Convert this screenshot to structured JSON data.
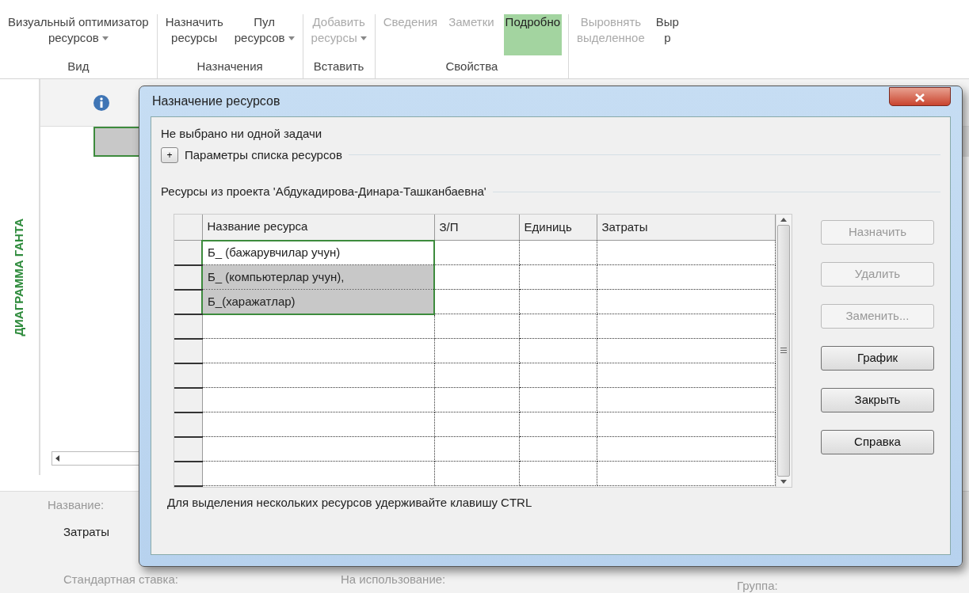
{
  "ribbon": {
    "groups": [
      {
        "label": "Вид",
        "commands": [
          {
            "lines": [
              "Визуальный оптимизатор",
              "ресурсов"
            ],
            "dropdown": true,
            "disabled": false,
            "selected": false
          }
        ]
      },
      {
        "label": "Назначения",
        "commands": [
          {
            "lines": [
              "Назначить",
              "ресурсы"
            ],
            "dropdown": false,
            "disabled": false,
            "selected": false
          },
          {
            "lines": [
              "Пул",
              "ресурсов"
            ],
            "dropdown": true,
            "disabled": false,
            "selected": false
          }
        ]
      },
      {
        "label": "Вставить",
        "commands": [
          {
            "lines": [
              "Добавить",
              "ресурсы"
            ],
            "dropdown": true,
            "disabled": true,
            "selected": false
          }
        ]
      },
      {
        "label": "Свойства",
        "commands": [
          {
            "lines": [
              "Сведения"
            ],
            "dropdown": false,
            "disabled": true,
            "selected": false
          },
          {
            "lines": [
              "Заметки"
            ],
            "dropdown": false,
            "disabled": true,
            "selected": false
          },
          {
            "lines": [
              "Подробно"
            ],
            "dropdown": false,
            "disabled": false,
            "selected": true
          }
        ]
      },
      {
        "commands": [
          {
            "lines": [
              "Выровнять",
              "выделенное"
            ],
            "dropdown": false,
            "disabled": true,
            "selected": false
          },
          {
            "lines": [
              "Выр",
              "р"
            ],
            "dropdown": false,
            "disabled": false,
            "selected": false
          }
        ]
      }
    ]
  },
  "view_bar": {
    "label": "ДИАГРАММА ГАНТА"
  },
  "details_form": {
    "name_label": "Название:",
    "group_title": "Затраты",
    "fields": [
      "Стандартная ставка:",
      "На использование:",
      "Группа:"
    ]
  },
  "dialog": {
    "title": "Назначение ресурсов",
    "task_status": "Не выбрано ни одной задачи",
    "options_toggle": "+",
    "options_label": "Параметры списка ресурсов",
    "resources_label": "Ресурсы из проекта 'Абдукадирова-Динара-Ташканбаевна'",
    "columns": [
      "Название ресурса",
      "З/П",
      "Единиць",
      "Затраты"
    ],
    "rows": [
      {
        "name": "Б_ (бажарувчилар учун)",
        "active": true,
        "selected": false
      },
      {
        "name": "Б_ (компьютерлар учун),",
        "active": false,
        "selected": true
      },
      {
        "name": "Б_(харажатлар)",
        "active": false,
        "selected": true
      },
      {
        "active": false,
        "selected": false
      },
      {
        "active": false,
        "selected": false
      },
      {
        "active": false,
        "selected": false
      },
      {
        "active": false,
        "selected": false
      },
      {
        "active": false,
        "selected": false
      },
      {
        "active": false,
        "selected": false
      },
      {
        "active": false,
        "selected": false
      }
    ],
    "buttons": [
      {
        "label": "Назначить",
        "disabled": true
      },
      {
        "label": "Удалить",
        "disabled": true
      },
      {
        "label": "Заменить...",
        "disabled": true
      },
      {
        "label": "График",
        "disabled": false
      },
      {
        "label": "Закрыть",
        "disabled": false
      },
      {
        "label": "Справка",
        "disabled": false
      }
    ],
    "hint": "Для выделения нескольких ресурсов удерживайте клавишу CTRL"
  }
}
